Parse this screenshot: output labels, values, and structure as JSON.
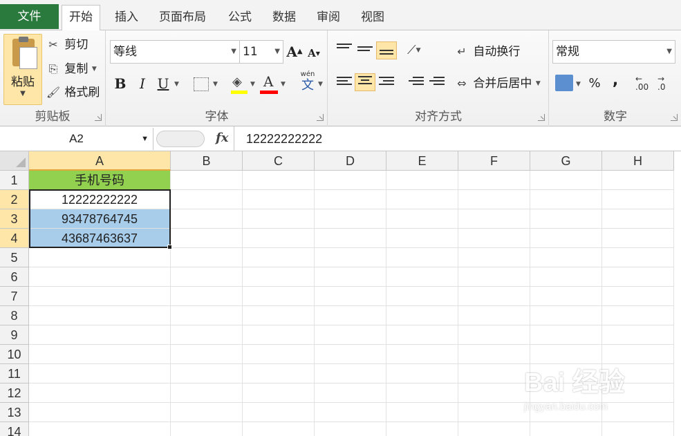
{
  "tabs": {
    "file": "文件",
    "items": [
      "开始",
      "插入",
      "页面布局",
      "公式",
      "数据",
      "审阅",
      "视图"
    ]
  },
  "clipboard": {
    "paste": "粘贴",
    "cut": "剪切",
    "copy": "复制",
    "format_painter": "格式刷",
    "group_label": "剪贴板"
  },
  "font": {
    "name": "等线",
    "size": "11",
    "bold": "B",
    "italic": "I",
    "underline": "U",
    "phonetic": "wén",
    "phonetic_char": "文",
    "group_label": "字体",
    "fill_color": "#ffff00",
    "font_color": "#ff0000"
  },
  "alignment": {
    "wrap_text": "自动换行",
    "merge_center": "合并后居中",
    "group_label": "对齐方式"
  },
  "number": {
    "format": "常规",
    "percent": "%",
    "comma": ",",
    "inc_decimal": ".00",
    "group_label": "数字"
  },
  "formula_bar": {
    "name_box": "A2",
    "fx": "fx",
    "value": "12222222222"
  },
  "sheet": {
    "columns": [
      "A",
      "B",
      "C",
      "D",
      "E",
      "F",
      "G",
      "H"
    ],
    "rows": [
      "1",
      "2",
      "3",
      "4",
      "5",
      "6",
      "7",
      "8",
      "9",
      "10",
      "11",
      "12",
      "13",
      "14"
    ],
    "column_a": [
      "手机号码",
      "12222222222",
      "93478764745",
      "43687463637"
    ],
    "header_color": "#92d050",
    "highlight_color": "#a8cdea"
  },
  "watermark": {
    "main": "Bai 经验",
    "sub": "jingyan.baidu.com"
  }
}
